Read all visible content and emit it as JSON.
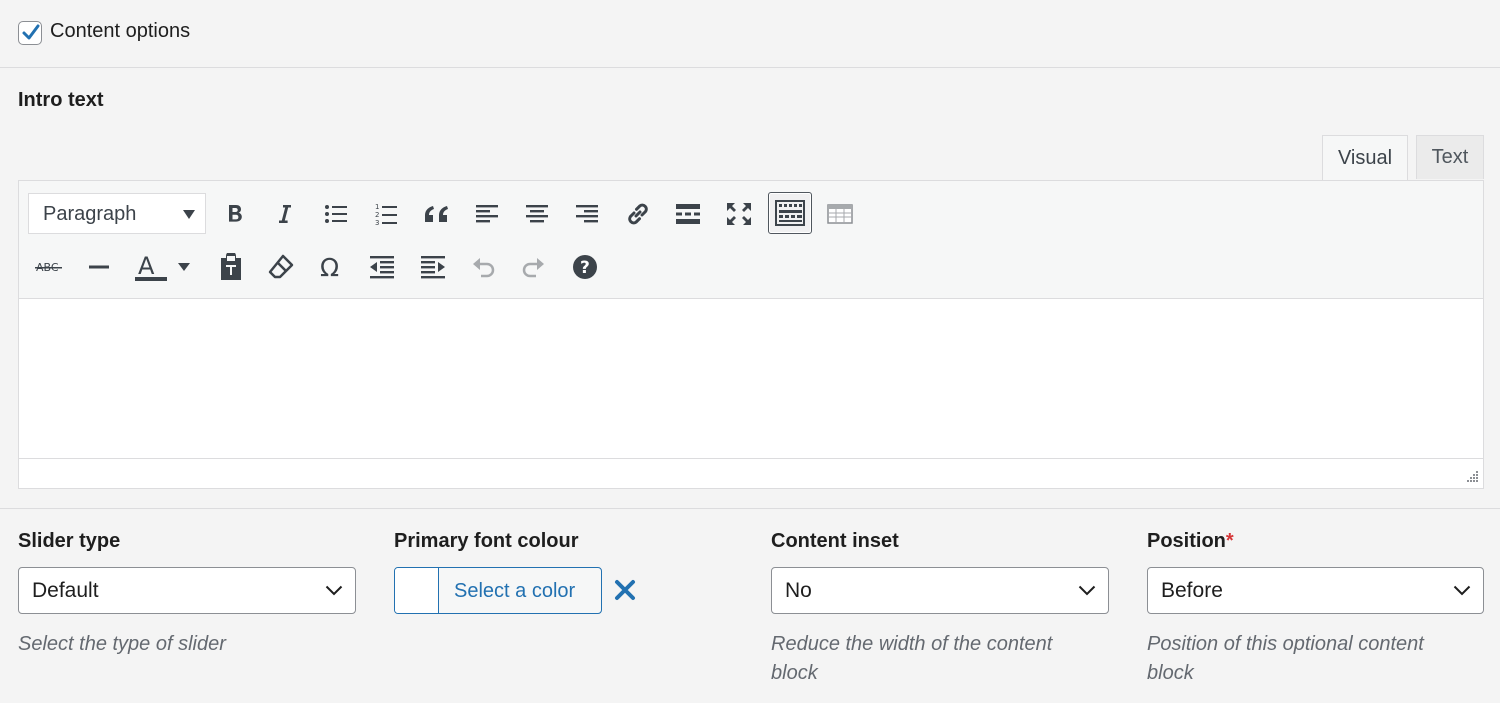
{
  "top": {
    "checkbox_label": "Content options",
    "checked": true
  },
  "intro": {
    "label": "Intro text"
  },
  "editor": {
    "tabs": {
      "visual": "Visual",
      "text": "Text"
    },
    "format_select": "Paragraph",
    "toolbar_row1": [
      "bold-icon",
      "italic-icon",
      "bullet-list-icon",
      "numbered-list-icon",
      "blockquote-icon",
      "align-left-icon",
      "align-center-icon",
      "align-right-icon",
      "link-icon",
      "read-more-icon",
      "fullscreen-icon",
      "toolbar-toggle-icon",
      "table-icon"
    ],
    "toolbar_row2": [
      "strikethrough-icon",
      "horizontal-line-icon",
      "text-color-icon",
      "paste-text-icon",
      "clear-formatting-icon",
      "special-character-icon",
      "outdent-icon",
      "indent-icon",
      "undo-icon",
      "redo-icon",
      "help-icon"
    ],
    "strikethrough_glyph": "ABC",
    "text_color_glyph": "A",
    "omega_glyph": "Ω"
  },
  "fields": {
    "slider_type": {
      "label": "Slider type",
      "value": "Default",
      "description": "Select the type of slider"
    },
    "primary_font_colour": {
      "label": "Primary font colour",
      "button": "Select a color"
    },
    "content_inset": {
      "label": "Content inset",
      "value": "No",
      "description_line1": "Reduce the width of the content",
      "description_line2": "block"
    },
    "position": {
      "label": "Position",
      "required": "*",
      "value": "Before",
      "description_line1": "Position of this optional content",
      "description_line2": "block"
    }
  },
  "colors": {
    "accent": "#2271b1",
    "required": "#d63638",
    "border": "#dcdcde"
  }
}
